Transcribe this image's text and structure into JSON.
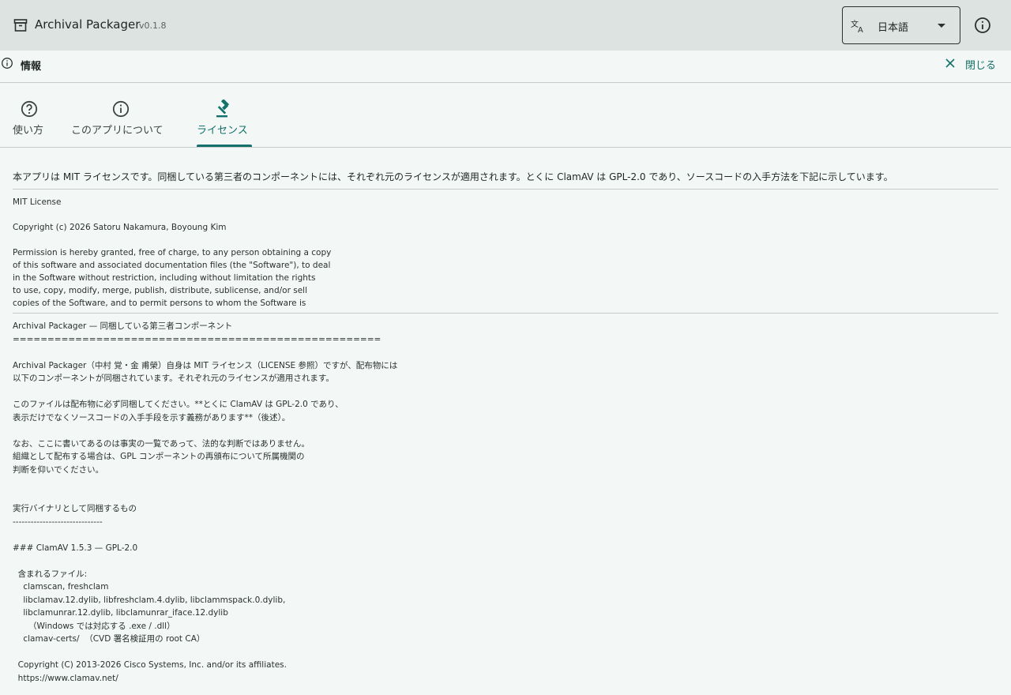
{
  "app": {
    "title": "Archival Packager",
    "version": "v0.1.8",
    "language_value": "日本語",
    "icon": "archive-box-icon"
  },
  "panel": {
    "title": "情報",
    "close_label": "閉じる"
  },
  "tabs": [
    {
      "label": "使い方",
      "icon": "help-circle-icon",
      "active": false
    },
    {
      "label": "このアプリについて",
      "icon": "info-circle-icon",
      "active": false
    },
    {
      "label": "ライセンス",
      "icon": "gavel-icon",
      "active": true
    }
  ],
  "license": {
    "intro": "本アプリは MIT ライセンスです。同梱している第三者のコンポーネントには、それぞれ元のライセンスが適用されます。とくに ClamAV は GPL-2.0 であり、ソースコードの入手方法を下記に示しています。",
    "mit_text": "MIT License\n\nCopyright (c) 2026 Satoru Nakamura, Boyoung Kim\n\nPermission is hereby granted, free of charge, to any person obtaining a copy\nof this software and associated documentation files (the \"Software\"), to deal\nin the Software without restriction, including without limitation the rights\nto use, copy, modify, merge, publish, distribute, sublicense, and/or sell\ncopies of the Software, and to permit persons to whom the Software is",
    "third_party_text": "Archival Packager — 同梱している第三者コンポーネント\n=====================================================\n\nArchival Packager（中村 覚・金 甫榮）自身は MIT ライセンス（LICENSE 参照）ですが、配布物には\n以下のコンポーネントが同梱されています。それぞれ元のライセンスが適用されます。\n\nこのファイルは配布物に必ず同梱してください。**とくに ClamAV は GPL-2.0 であり、\n表示だけでなくソースコードの入手手段を示す義務があります**（後述）。\n\nなお、ここに書いてあるのは事実の一覧であって、法的な判断ではありません。\n組織として配布する場合は、GPL コンポーネントの再頒布について所属機関の\n判断を仰いでください。\n\n\n実行バイナリとして同梱するもの\n------------------------------\n\n### ClamAV 1.5.3 — GPL-2.0\n\n  含まれるファイル:\n    clamscan, freshclam\n    libclamav.12.dylib, libfreshclam.4.dylib, libclammspack.0.dylib,\n    libclamunrar.12.dylib, libclamunrar_iface.12.dylib\n      （Windows では対応する .exe / .dll）\n    clamav-certs/  （CVD 署名検証用の root CA）\n\n  Copyright (C) 2013-2026 Cisco Systems, Inc. and/or its affiliates.\n  https://www.clamav.net/"
  },
  "colors": {
    "accent": "#14706a",
    "appbar_bg": "#dde3e1",
    "page_bg": "#f3f8f6"
  }
}
